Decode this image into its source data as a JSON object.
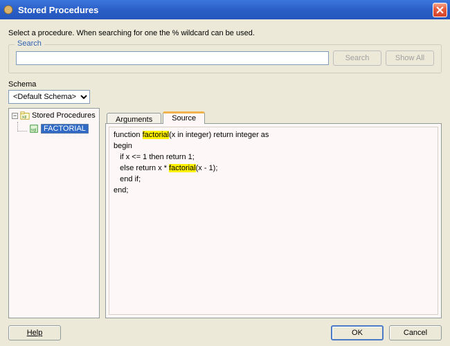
{
  "window": {
    "title": "Stored Procedures"
  },
  "instruction": "Select a procedure. When searching for one the % wildcard can be used.",
  "search": {
    "legend": "Search",
    "value": "",
    "search_btn": "Search",
    "show_all_btn": "Show All"
  },
  "schema": {
    "label": "Schema",
    "selected": "<Default Schema>"
  },
  "tree": {
    "root_label": "Stored Procedures",
    "items": [
      {
        "label": "FACTORIAL",
        "selected": true
      }
    ]
  },
  "tabs": {
    "arguments": "Arguments",
    "source": "Source",
    "active": "source"
  },
  "source": {
    "line1_pre": "function ",
    "line1_hl": "factorial",
    "line1_post": "(x in integer) return integer as",
    "line2": "begin",
    "line3": "   if x <= 1 then return 1;",
    "line4_pre": "   else return x * ",
    "line4_hl": "factorial",
    "line4_post": "(x - 1);",
    "line5": "   end if;",
    "line6": "end;"
  },
  "buttons": {
    "help": "Help",
    "ok": "OK",
    "cancel": "Cancel"
  }
}
